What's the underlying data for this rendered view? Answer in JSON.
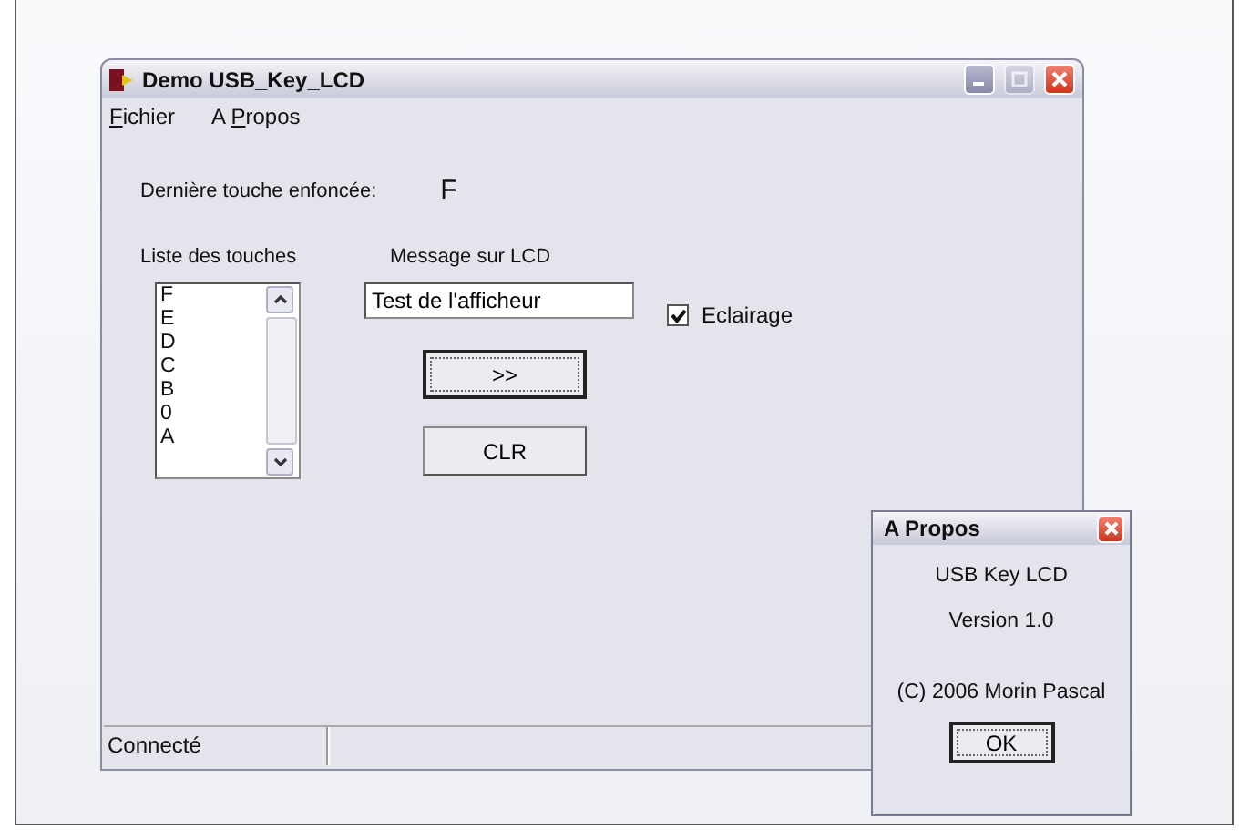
{
  "main_window": {
    "title": "Demo USB_Key_LCD",
    "title_buttons": [
      {
        "kind": "minimize",
        "disabled": false
      },
      {
        "kind": "maximize",
        "disabled": true
      },
      {
        "kind": "close",
        "disabled": false
      }
    ],
    "menu": [
      {
        "mnemonic": "F",
        "suffix": "ichier"
      },
      {
        "prefix": "A ",
        "mnemonic": "P",
        "suffix": "ropos"
      }
    ],
    "last_key": {
      "label": "Dernière touche enfoncée:",
      "value": "F"
    },
    "key_list": {
      "label": "Liste des touches",
      "items": [
        "F",
        "E",
        "D",
        "C",
        "B",
        "0",
        "A"
      ]
    },
    "lcd_message": {
      "label": "Message sur LCD",
      "value": "Test de l'afficheur"
    },
    "backlight": {
      "label": "Eclairage",
      "checked": true
    },
    "buttons": [
      {
        "label": ">>",
        "default": true
      },
      {
        "label": "CLR",
        "default": false
      }
    ],
    "status_bar": [
      "Connecté"
    ]
  },
  "about_dialog": {
    "title": "A Propos",
    "lines": [
      "USB Key LCD",
      "Version 1.0",
      "(C) 2006 Morin Pascal"
    ],
    "button": {
      "label": "OK",
      "default": true
    }
  }
}
